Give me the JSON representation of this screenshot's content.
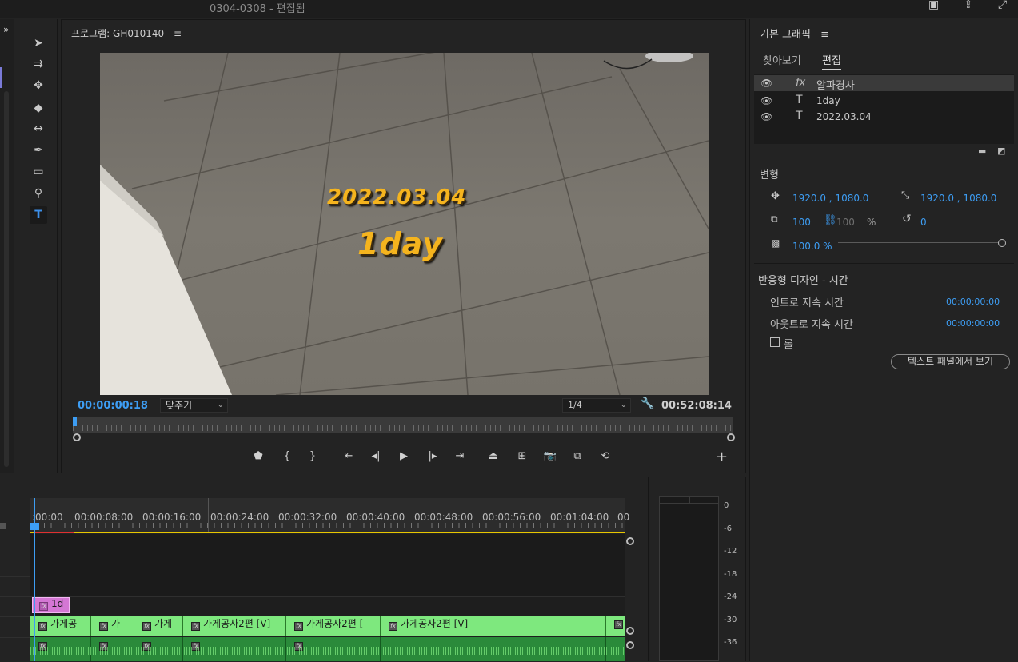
{
  "window": {
    "title": "0304-0308 - 편집됨"
  },
  "program_monitor": {
    "title": "프로그램: GH010140",
    "menu_icon": "≡",
    "overlay_date": "2022.03.04",
    "overlay_day": "1day",
    "current_timecode": "00:00:00:18",
    "fit_value": "맞추기",
    "resolution_value": "1/4",
    "duration_timecode": "00:52:08:14"
  },
  "essential_graphics": {
    "title": "기본 그래픽",
    "menu_icon": "≡",
    "tabs": [
      {
        "label": "찾아보기"
      },
      {
        "label": "편집"
      }
    ],
    "layers": [
      {
        "icon": "fx-icon",
        "name": "알파경사"
      },
      {
        "icon": "text-icon",
        "name": "1day"
      },
      {
        "icon": "text-icon",
        "name": "2022.03.04"
      }
    ],
    "transform": {
      "title": "변형",
      "position": "1920.0 , 1080.0",
      "anchor": "1920.0 , 1080.0",
      "scale": "100",
      "scale_linked": "100",
      "percent": "%",
      "rotation": "0",
      "opacity": "100.0 %"
    },
    "responsive": {
      "title": "반응형 디자인 - 시간",
      "intro_label": "인트로 지속 시간",
      "intro_value": "00:00:00:00",
      "outro_label": "아웃트로 지속 시간",
      "outro_value": "00:00:00:00",
      "roll_label": "롤",
      "roll_checked": false,
      "show_in_text_panel": "텍스트 패널에서 보기"
    }
  },
  "timeline": {
    "ruler_labels": [
      ":00:00",
      "00:00:08:00",
      "00:00:16:00",
      "00:00:24:00",
      "00:00:32:00",
      "00:00:40:00",
      "00:00:48:00",
      "00:00:56:00",
      "00:01:04:00",
      "00"
    ],
    "graphic_clip": "1d",
    "video_clips": [
      "가게공",
      "가",
      "가게",
      "가게공사2편 [V]",
      "가게공사2편 [",
      "가게공사2편 [V]"
    ]
  },
  "audio_meter": {
    "labels": [
      "0",
      "-6",
      "-12",
      "-18",
      "-24",
      "-30",
      "-36"
    ]
  },
  "colors": {
    "accent_blue": "#3d9df3",
    "overlay_text": "#f5b41e",
    "video_clip": "#7ee87e",
    "graphic_clip": "#d477d4"
  }
}
